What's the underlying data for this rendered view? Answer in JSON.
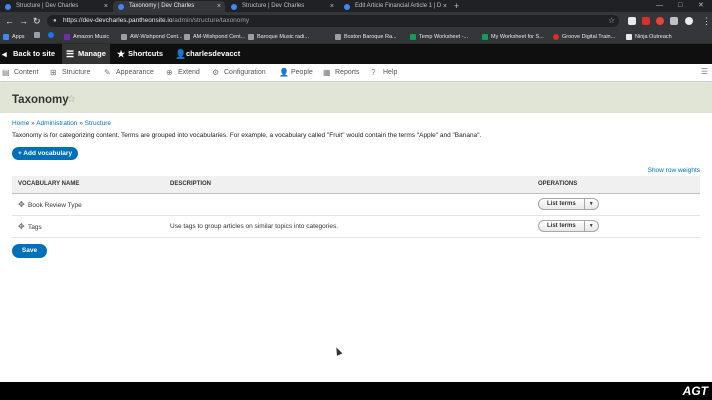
{
  "browser": {
    "tabs": [
      {
        "title": "Structure | Dev Charles"
      },
      {
        "title": "Taxonomy | Dev Charles"
      },
      {
        "title": "Structure | Dev Charles"
      },
      {
        "title": "Edit Article Financial Article 1 | D"
      }
    ],
    "url_host": "https://dev-devcharles.pantheonsite.io",
    "url_path": "/admin/structure/taxonomy",
    "bookmarks": [
      "Apps",
      "Amazon Music",
      "AW-Wishpond Cent...",
      "AM-Wishpond Cent...",
      "Baroque Music radi...",
      "Boston Baroque Ra...",
      "Temp Worksheet -...",
      "My Worksheet for S...",
      "Groove Digital Train...",
      "Ninja Outreach"
    ]
  },
  "toolbar": {
    "back_label": "Back to site",
    "manage_label": "Manage",
    "shortcuts_label": "Shortcuts",
    "user_label": "charlesdevacct"
  },
  "tray": {
    "items": [
      "Content",
      "Structure",
      "Appearance",
      "Extend",
      "Configuration",
      "People",
      "Reports",
      "Help"
    ]
  },
  "page": {
    "title": "Taxonomy",
    "breadcrumb": [
      "Home",
      "Administration",
      "Structure"
    ],
    "breadcrumb_sep": "»",
    "description": "Taxonomy is for categorizing content. Terms are grouped into vocabularies. For example, a vocabulary called \"Fruit\" would contain the terms \"Apple\" and \"Banana\".",
    "add_button": "+ Add vocabulary",
    "show_weights": "Show row weights",
    "save_button": "Save"
  },
  "table": {
    "headers": [
      "VOCABULARY NAME",
      "DESCRIPTION",
      "OPERATIONS"
    ],
    "rows": [
      {
        "name": "Book Review Type",
        "description": "",
        "operation": "List terms"
      },
      {
        "name": "Tags",
        "description": "Use tags to group articles on similar topics into categories.",
        "operation": "List terms"
      }
    ]
  },
  "watermark": "AGT",
  "colors": {
    "accent": "#0071b8",
    "header_bg": "#e0e5d6",
    "toolbar_bg": "#0f0f0f"
  }
}
